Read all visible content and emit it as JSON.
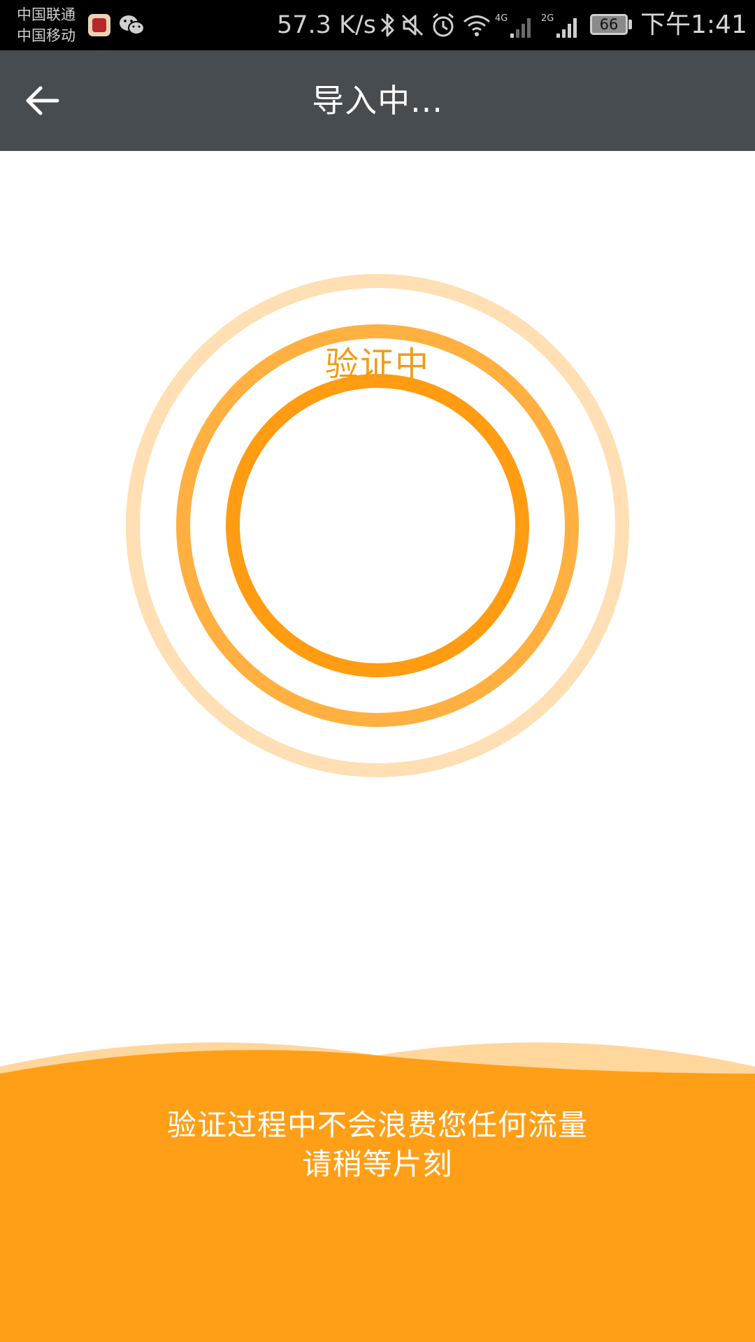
{
  "status_bar": {
    "carrier_1": "中国联通",
    "carrier_2": "中国移动",
    "net_speed": "57.3 K/s",
    "network_1": "4G",
    "network_2": "2G",
    "battery_level": "66",
    "time": "下午1:41",
    "icons": [
      "app-notification-icon",
      "wechat-icon",
      "bluetooth-icon",
      "mute-icon",
      "alarm-icon",
      "wifi-icon",
      "signal-icon",
      "battery-icon"
    ]
  },
  "app_bar": {
    "title": "导入中...",
    "back_icon": "arrow-left-icon"
  },
  "progress": {
    "label": "验证中"
  },
  "footer": {
    "line_1": "验证过程中不会浪费您任何流量",
    "line_2": "请稍等片刻"
  },
  "colors": {
    "app_bar": "#474c50",
    "accent": "#f29b18",
    "ring_inner": "#ff9c12",
    "ring_middle": "#ffb040",
    "ring_outer": "#ffdfb3",
    "footer": "#ff9f17"
  }
}
